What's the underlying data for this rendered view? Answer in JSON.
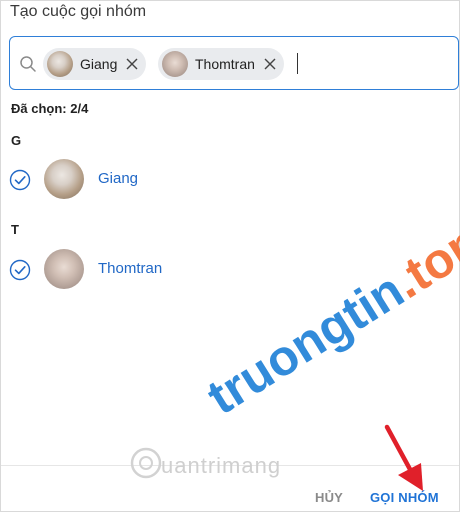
{
  "dialog": {
    "title": "Tạo cuộc gọi nhóm"
  },
  "search": {
    "chips": [
      {
        "name": "Giang",
        "avatar": "giang-avatar"
      },
      {
        "name": "Thomtran",
        "avatar": "thomtran-avatar"
      }
    ]
  },
  "selected": {
    "label": "Đã chọn:",
    "value": "2/4"
  },
  "groups": [
    {
      "letter": "G",
      "contacts": [
        {
          "name": "Giang",
          "checked": true
        }
      ]
    },
    {
      "letter": "T",
      "contacts": [
        {
          "name": "Thomtran",
          "checked": true
        }
      ]
    }
  ],
  "footer": {
    "cancel_label": "HỦY",
    "call_label": "GỌI NHÓM"
  },
  "watermark": {
    "main": "truongtin",
    "accent": ".top",
    "sub": "uantrimang"
  },
  "colors": {
    "accent": "#2f7fd8",
    "link": "#2168c6",
    "arrow": "#e0202a"
  }
}
